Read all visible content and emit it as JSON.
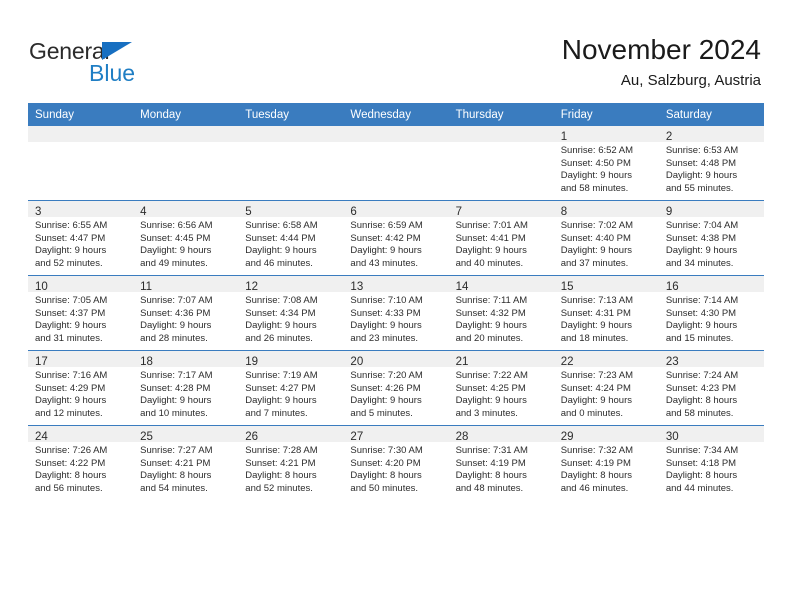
{
  "brand": {
    "name_part1": "General",
    "name_part2": "Blue",
    "flag_icon": "blue-triangle-flag",
    "accent_color": "#1f7ec4"
  },
  "header": {
    "title": "November 2024",
    "subtitle": "Au, Salzburg, Austria"
  },
  "theme": {
    "header_blue": "#3a7cbf",
    "daynum_band": "#f0f0f0",
    "text": "#2c2c2c"
  },
  "weekday_headers": [
    "Sunday",
    "Monday",
    "Tuesday",
    "Wednesday",
    "Thursday",
    "Friday",
    "Saturday"
  ],
  "weeks": [
    {
      "days": [
        {
          "day": "",
          "lines": []
        },
        {
          "day": "",
          "lines": []
        },
        {
          "day": "",
          "lines": []
        },
        {
          "day": "",
          "lines": []
        },
        {
          "day": "",
          "lines": []
        },
        {
          "day": "1",
          "lines": [
            "Sunrise: 6:52 AM",
            "Sunset: 4:50 PM",
            "Daylight: 9 hours",
            "and 58 minutes."
          ]
        },
        {
          "day": "2",
          "lines": [
            "Sunrise: 6:53 AM",
            "Sunset: 4:48 PM",
            "Daylight: 9 hours",
            "and 55 minutes."
          ]
        }
      ]
    },
    {
      "days": [
        {
          "day": "3",
          "lines": [
            "Sunrise: 6:55 AM",
            "Sunset: 4:47 PM",
            "Daylight: 9 hours",
            "and 52 minutes."
          ]
        },
        {
          "day": "4",
          "lines": [
            "Sunrise: 6:56 AM",
            "Sunset: 4:45 PM",
            "Daylight: 9 hours",
            "and 49 minutes."
          ]
        },
        {
          "day": "5",
          "lines": [
            "Sunrise: 6:58 AM",
            "Sunset: 4:44 PM",
            "Daylight: 9 hours",
            "and 46 minutes."
          ]
        },
        {
          "day": "6",
          "lines": [
            "Sunrise: 6:59 AM",
            "Sunset: 4:42 PM",
            "Daylight: 9 hours",
            "and 43 minutes."
          ]
        },
        {
          "day": "7",
          "lines": [
            "Sunrise: 7:01 AM",
            "Sunset: 4:41 PM",
            "Daylight: 9 hours",
            "and 40 minutes."
          ]
        },
        {
          "day": "8",
          "lines": [
            "Sunrise: 7:02 AM",
            "Sunset: 4:40 PM",
            "Daylight: 9 hours",
            "and 37 minutes."
          ]
        },
        {
          "day": "9",
          "lines": [
            "Sunrise: 7:04 AM",
            "Sunset: 4:38 PM",
            "Daylight: 9 hours",
            "and 34 minutes."
          ]
        }
      ]
    },
    {
      "days": [
        {
          "day": "10",
          "lines": [
            "Sunrise: 7:05 AM",
            "Sunset: 4:37 PM",
            "Daylight: 9 hours",
            "and 31 minutes."
          ]
        },
        {
          "day": "11",
          "lines": [
            "Sunrise: 7:07 AM",
            "Sunset: 4:36 PM",
            "Daylight: 9 hours",
            "and 28 minutes."
          ]
        },
        {
          "day": "12",
          "lines": [
            "Sunrise: 7:08 AM",
            "Sunset: 4:34 PM",
            "Daylight: 9 hours",
            "and 26 minutes."
          ]
        },
        {
          "day": "13",
          "lines": [
            "Sunrise: 7:10 AM",
            "Sunset: 4:33 PM",
            "Daylight: 9 hours",
            "and 23 minutes."
          ]
        },
        {
          "day": "14",
          "lines": [
            "Sunrise: 7:11 AM",
            "Sunset: 4:32 PM",
            "Daylight: 9 hours",
            "and 20 minutes."
          ]
        },
        {
          "day": "15",
          "lines": [
            "Sunrise: 7:13 AM",
            "Sunset: 4:31 PM",
            "Daylight: 9 hours",
            "and 18 minutes."
          ]
        },
        {
          "day": "16",
          "lines": [
            "Sunrise: 7:14 AM",
            "Sunset: 4:30 PM",
            "Daylight: 9 hours",
            "and 15 minutes."
          ]
        }
      ]
    },
    {
      "days": [
        {
          "day": "17",
          "lines": [
            "Sunrise: 7:16 AM",
            "Sunset: 4:29 PM",
            "Daylight: 9 hours",
            "and 12 minutes."
          ]
        },
        {
          "day": "18",
          "lines": [
            "Sunrise: 7:17 AM",
            "Sunset: 4:28 PM",
            "Daylight: 9 hours",
            "and 10 minutes."
          ]
        },
        {
          "day": "19",
          "lines": [
            "Sunrise: 7:19 AM",
            "Sunset: 4:27 PM",
            "Daylight: 9 hours",
            "and 7 minutes."
          ]
        },
        {
          "day": "20",
          "lines": [
            "Sunrise: 7:20 AM",
            "Sunset: 4:26 PM",
            "Daylight: 9 hours",
            "and 5 minutes."
          ]
        },
        {
          "day": "21",
          "lines": [
            "Sunrise: 7:22 AM",
            "Sunset: 4:25 PM",
            "Daylight: 9 hours",
            "and 3 minutes."
          ]
        },
        {
          "day": "22",
          "lines": [
            "Sunrise: 7:23 AM",
            "Sunset: 4:24 PM",
            "Daylight: 9 hours",
            "and 0 minutes."
          ]
        },
        {
          "day": "23",
          "lines": [
            "Sunrise: 7:24 AM",
            "Sunset: 4:23 PM",
            "Daylight: 8 hours",
            "and 58 minutes."
          ]
        }
      ]
    },
    {
      "days": [
        {
          "day": "24",
          "lines": [
            "Sunrise: 7:26 AM",
            "Sunset: 4:22 PM",
            "Daylight: 8 hours",
            "and 56 minutes."
          ]
        },
        {
          "day": "25",
          "lines": [
            "Sunrise: 7:27 AM",
            "Sunset: 4:21 PM",
            "Daylight: 8 hours",
            "and 54 minutes."
          ]
        },
        {
          "day": "26",
          "lines": [
            "Sunrise: 7:28 AM",
            "Sunset: 4:21 PM",
            "Daylight: 8 hours",
            "and 52 minutes."
          ]
        },
        {
          "day": "27",
          "lines": [
            "Sunrise: 7:30 AM",
            "Sunset: 4:20 PM",
            "Daylight: 8 hours",
            "and 50 minutes."
          ]
        },
        {
          "day": "28",
          "lines": [
            "Sunrise: 7:31 AM",
            "Sunset: 4:19 PM",
            "Daylight: 8 hours",
            "and 48 minutes."
          ]
        },
        {
          "day": "29",
          "lines": [
            "Sunrise: 7:32 AM",
            "Sunset: 4:19 PM",
            "Daylight: 8 hours",
            "and 46 minutes."
          ]
        },
        {
          "day": "30",
          "lines": [
            "Sunrise: 7:34 AM",
            "Sunset: 4:18 PM",
            "Daylight: 8 hours",
            "and 44 minutes."
          ]
        }
      ]
    }
  ]
}
